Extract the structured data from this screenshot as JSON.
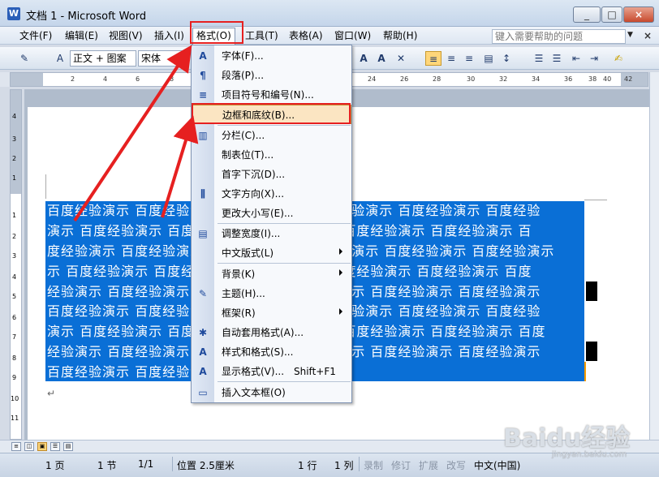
{
  "window": {
    "title": "文档 1 - Microsoft Word",
    "min": "_",
    "max": "□",
    "close": "×"
  },
  "menubar": {
    "items": [
      {
        "label": "文件(F)"
      },
      {
        "label": "编辑(E)"
      },
      {
        "label": "视图(V)"
      },
      {
        "label": "插入(I)"
      },
      {
        "label": "格式(O)"
      },
      {
        "label": "工具(T)"
      },
      {
        "label": "表格(A)"
      },
      {
        "label": "窗口(W)"
      },
      {
        "label": "帮助(H)"
      }
    ],
    "help_placeholder": "键入需要帮助的问题",
    "close": "×"
  },
  "toolbar": {
    "style_value": "正文 + 图案",
    "font_value": "宋体",
    "font_a1": "A",
    "font_a2": "A"
  },
  "ruler": {
    "h_ticks": [
      "2",
      "4",
      "6",
      "8",
      "10",
      "12",
      "24",
      "26",
      "28",
      "30",
      "32",
      "34",
      "36",
      "38",
      "40",
      "42"
    ],
    "v_ticks": [
      "4",
      "3",
      "2",
      "1",
      "1",
      "2",
      "3",
      "4",
      "5",
      "6",
      "7",
      "8",
      "9",
      "10",
      "11"
    ]
  },
  "document": {
    "lines": [
      "百度经验演示  百度经验演示  百度经验演示  百度经验演示  百度经验演示  百度经验",
      "演示  百度经验演示  百度经验演示  百度经验演示  百度经验演示  百度经验演示  百",
      "度经验演示  百度经验演示  百度经验演示  百度经验演示  百度经验演示  百度经验演示",
      "示  百度经验演示  百度经验演示  百度经验演示  百度经验演示  百度经验演示  百度",
      "经验演示  百度经验演示  百度经验演示  百度经验演示  百度经验演示  百度经验演示",
      "百度经验演示  百度经验演示  百度经验演示  百度经验演示  百度经验演示  百度经验",
      "演示  百度经验演示  百度经验演示  百度经验演示  百度经验演示  百度经验演示  百度",
      "经验演示  百度经验演示  百度经验演示  百度经验演示  百度经验演示  百度经验演示",
      "百度经验演示  百度经验演示"
    ],
    "para_mark": "↵"
  },
  "format_menu": {
    "items": [
      {
        "icon": "A",
        "label": "字体(F)...",
        "shortcut": "",
        "submenu": false
      },
      {
        "icon": "¶",
        "label": "段落(P)...",
        "shortcut": "",
        "submenu": false
      },
      {
        "icon": "≡",
        "label": "项目符号和编号(N)...",
        "shortcut": "",
        "submenu": false
      },
      {
        "icon": "",
        "label": "边框和底纹(B)...",
        "shortcut": "",
        "submenu": false
      },
      {
        "icon": "▥",
        "label": "分栏(C)...",
        "shortcut": "",
        "submenu": false
      },
      {
        "icon": "",
        "label": "制表位(T)...",
        "shortcut": "",
        "submenu": false
      },
      {
        "icon": "",
        "label": "首字下沉(D)...",
        "shortcut": "",
        "submenu": false
      },
      {
        "icon": "⫼",
        "label": "文字方向(X)...",
        "shortcut": "",
        "submenu": false
      },
      {
        "icon": "",
        "label": "更改大小写(E)...",
        "shortcut": "",
        "submenu": false
      },
      {
        "icon": "▤",
        "label": "调整宽度(I)...",
        "shortcut": "",
        "submenu": false
      },
      {
        "icon": "",
        "label": "中文版式(L)",
        "shortcut": "",
        "submenu": true
      },
      {
        "icon": "",
        "label": "背景(K)",
        "shortcut": "",
        "submenu": true
      },
      {
        "icon": "✎",
        "label": "主题(H)...",
        "shortcut": "",
        "submenu": false
      },
      {
        "icon": "",
        "label": "框架(R)",
        "shortcut": "",
        "submenu": true
      },
      {
        "icon": "✱",
        "label": "自动套用格式(A)...",
        "shortcut": "",
        "submenu": false
      },
      {
        "icon": "A",
        "label": "样式和格式(S)...",
        "shortcut": "",
        "submenu": false
      },
      {
        "icon": "A",
        "label": "显示格式(V)...",
        "shortcut": "Shift+F1",
        "submenu": false
      },
      {
        "icon": "▭",
        "label": "插入文本框(O)",
        "shortcut": "",
        "submenu": false
      }
    ]
  },
  "status": {
    "page": "1 页",
    "section": "1 节",
    "pages": "1/1",
    "position": "位置 2.5厘米",
    "line": "1 行",
    "col": "1 列",
    "rec": "录制",
    "trk": "修订",
    "ext": "扩展",
    "ovr": "改写",
    "lang": "中文(中国)"
  },
  "watermark": {
    "text": "Baidu经验",
    "url": "jingyan.baidu.com"
  },
  "colors": {
    "selection": "#0a6fd6",
    "shading": "#f59b00",
    "annotation": "#e62020"
  }
}
